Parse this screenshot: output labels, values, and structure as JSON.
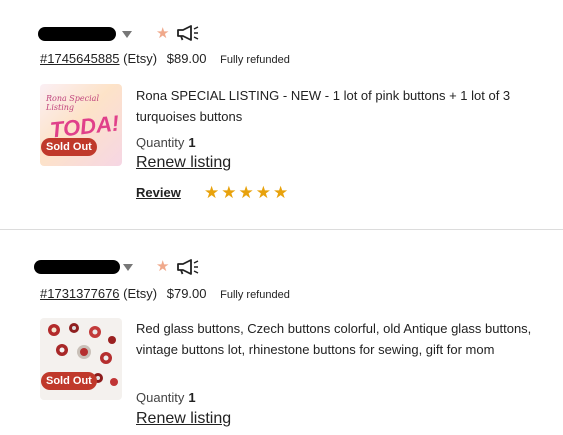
{
  "orders": [
    {
      "order_number": "#1745645885",
      "source": "(Etsy)",
      "price": "$89.00",
      "status": "Fully refunded",
      "thumbnail_text": "Rona Special Listing",
      "thumbnail_big_text": "TODA!",
      "badge": "Sold Out",
      "title": "Rona SPECIAL LISTING - NEW - 1 lot of pink buttons + 1 lot of 3 turquoises buttons",
      "quantity_label": "Quantity",
      "quantity_value": "1",
      "renew_label": "Renew listing",
      "review_label": "Review",
      "rating": 5,
      "rating_stars": "★★★★★"
    },
    {
      "order_number": "#1731377676",
      "source": "(Etsy)",
      "price": "$79.00",
      "status": "Fully refunded",
      "badge": "Sold Out",
      "title": "Red glass buttons, Czech buttons colorful, old Antique glass buttons, vintage buttons lot, rhinestone buttons for sewing, gift for mom",
      "quantity_label": "Quantity",
      "quantity_value": "1",
      "renew_label": "Renew listing"
    }
  ],
  "icons": {
    "star_mark": "★",
    "star_mark_color": "#f0a98c",
    "rating_color": "#e8a20c",
    "badge_color": "#c0392b"
  }
}
